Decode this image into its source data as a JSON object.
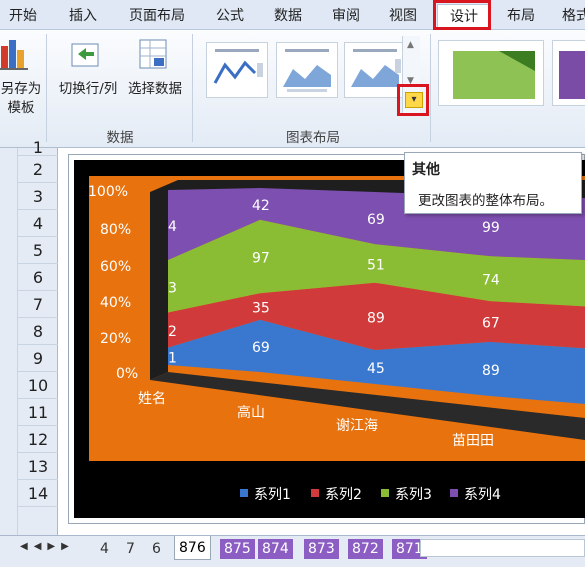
{
  "tabs": [
    {
      "label": "开始"
    },
    {
      "label": "插入"
    },
    {
      "label": "页面布局"
    },
    {
      "label": "公式"
    },
    {
      "label": "数据"
    },
    {
      "label": "审阅"
    },
    {
      "label": "视图"
    },
    {
      "label": "设计"
    },
    {
      "label": "布局"
    },
    {
      "label": "格式"
    }
  ],
  "ribbon": {
    "save_as_template": "另存为\n模板",
    "switch_rowcol": "切换行/列",
    "select_data": "选择数据",
    "group_data": "数据",
    "group_layout": "图表布局"
  },
  "tooltip": {
    "title": "其他",
    "body": "更改图表的整体布局。"
  },
  "rows": [
    "1",
    "2",
    "3",
    "4",
    "5",
    "6",
    "7",
    "8",
    "9",
    "10",
    "11",
    "12",
    "13",
    "14"
  ],
  "chart_data": {
    "type": "area",
    "stacked": "100%",
    "y_ticks": [
      "100%",
      "80%",
      "60%",
      "40%",
      "20%",
      "0%"
    ],
    "categories": [
      "姓名",
      "高山",
      "谢江海",
      "苗田田"
    ],
    "series": [
      {
        "name": "系列1",
        "color": "#3a78d0",
        "values": [
          1,
          69,
          45,
          89
        ]
      },
      {
        "name": "系列2",
        "color": "#d03a3a",
        "values": [
          2,
          35,
          89,
          67
        ]
      },
      {
        "name": "系列3",
        "color": "#8bbd34",
        "values": [
          3,
          97,
          51,
          74
        ]
      },
      {
        "name": "系列4",
        "color": "#7d4fb0",
        "values": [
          4,
          42,
          69,
          99
        ]
      }
    ],
    "legend_position": "bottom"
  },
  "sheet_tabs": [
    {
      "label": "4"
    },
    {
      "label": "7"
    },
    {
      "label": "6"
    },
    {
      "label": "876"
    },
    {
      "label": "875"
    },
    {
      "label": "874"
    },
    {
      "label": "873"
    },
    {
      "label": "872"
    },
    {
      "label": "871"
    }
  ],
  "active_sheet": "876"
}
